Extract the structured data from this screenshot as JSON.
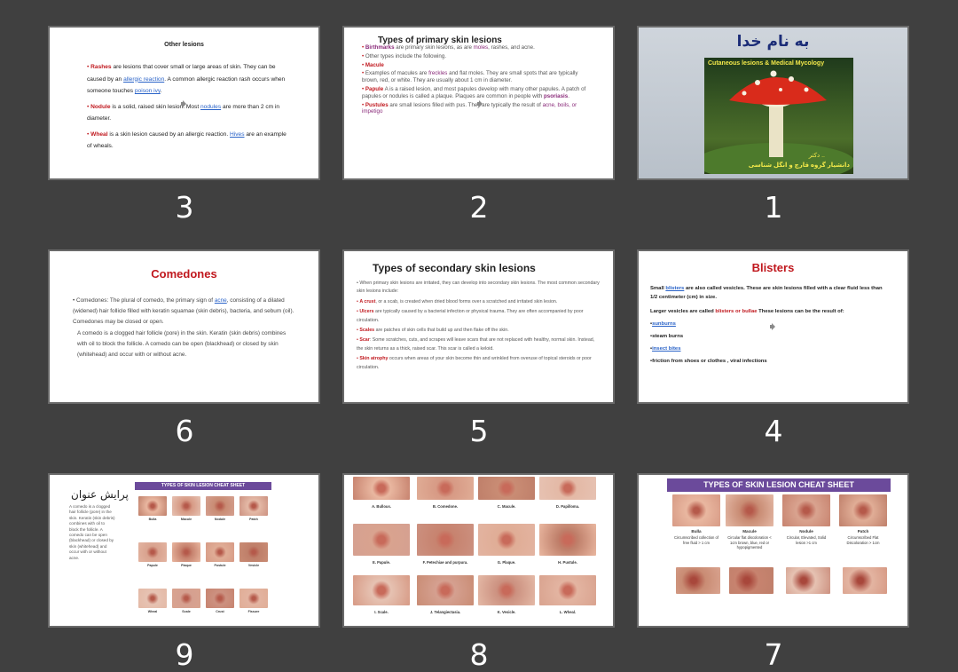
{
  "colors": {
    "background": "#404040",
    "accent_red": "#c0181e",
    "link": "#2a63c8",
    "purple": "#8a2b7a",
    "ribbon": "#6b4a9b"
  },
  "slides": {
    "s1": {
      "number": "1",
      "title": "به نام خدا",
      "subtitle": "Cutaneous lesions & Medical Mycology",
      "author": "دکتر ..",
      "affiliation": "دانشیار گروه قارچ و انگل شناسی"
    },
    "s2": {
      "number": "2",
      "title": "Types of primary skin lesions",
      "items": [
        {
          "head": "Birthmarks",
          "text": " are primary skin lesions, as are ",
          "link": "moles",
          "tail": ", rashes, and acne."
        },
        {
          "head": "",
          "text": "Other types include the following.",
          "link": "",
          "tail": ""
        },
        {
          "head": "Macule",
          "text": "",
          "link": "",
          "tail": ""
        },
        {
          "head": "",
          "text": "Examples of macules are ",
          "link": "freckles",
          "tail": " and flat moles. They are small spots that are typically brown, red, or white. They are usually about 1 cm in diameter."
        },
        {
          "head": "Papule",
          "text": "A  is a raised lesion, and most papules develop with many other papules. A patch of papules or nodules is called a plaque. Plaques are common in people with ",
          "link": "psoriasis",
          "tail": "."
        },
        {
          "head": "Pustules",
          "text": " are small lesions filled with pus. They are typically the result of ",
          "link": "acne, boils,",
          "tail": " or impetigo"
        }
      ]
    },
    "s3": {
      "number": "3",
      "title": "Other lesions",
      "items": [
        {
          "head": "Rashes",
          "text": " are lesions that cover small or large areas of skin. They can be caused by an ",
          "link": "allergic reaction",
          "tail": ". A common allergic reaction rash occurs when someone touches ",
          "link2": "poison ivy",
          "tail2": "."
        },
        {
          "head": "Nodule",
          "text": " is a solid, raised skin lesion. Most ",
          "link": "nodules",
          "tail": " are more than 2 cm in diameter.",
          "link2": "",
          "tail2": ""
        },
        {
          "head": "Wheal",
          "text": " is a skin lesion caused by an allergic reaction. ",
          "link": "Hives",
          "tail": " are an example of wheals.",
          "link2": "",
          "tail2": ""
        }
      ]
    },
    "s4": {
      "number": "4",
      "title": "Blisters",
      "line1a": "Small ",
      "line1link": "blisters",
      "line1b": " are also called vesicles. These are skin lesions filled with a clear fluid less than 1/2 centimeter (cm) in size.",
      "line2a": " Larger vesicles are called ",
      "line2red": "blisters or bullae",
      "line2b": " These lesions can be the result of:",
      "list": [
        "sunburns",
        "steam burns",
        "insect bites",
        "friction from shoes or clothes , viral infections"
      ]
    },
    "s5": {
      "number": "5",
      "title": "Types of secondary skin lesions",
      "intro": "When primary skin lesions are irritated, they can develop into secondary skin lesions. The most common secondary skin lesions include:",
      "items": [
        {
          "head": "A crust",
          "text": ", or a scab, is created when dried blood forms over a scratched and irritated skin lesion."
        },
        {
          "head": "Ulcers",
          "text": " are typically caused by a bacterial infection or physical trauma. They are often accompanied by poor circulation."
        },
        {
          "head": "Scales",
          "text": " are patches of skin cells that build up and then flake off the skin."
        },
        {
          "head": "Scar",
          "text": ": Some scratches, cuts, and scrapes will leave scars that are not replaced with healthy, normal skin. Instead, the skin returns as a thick, raised scar. This scar is called a keloid."
        },
        {
          "head": "Skin atrophy",
          "text": " occurs when areas of your skin become thin and wrinkled from overuse of topical steroids or poor circulation."
        }
      ]
    },
    "s6": {
      "number": "6",
      "title": "Comedones",
      "para1a": "Comedones: The plural of comedo, the primary sign of ",
      "para1link": "acne",
      "para1b": ", consisting of a dilated (widened) hair follicle filled with keratin squamae (skin debris), bacteria, and sebum (oil). Comedones may be closed or open.",
      "para2": "A comedo is a clogged hair follicle (pore) in the skin. Keratin (skin debris) combines with oil to block the follicle. A comedo can be open (blackhead) or closed by skin (whitehead) and occur with or without acne."
    },
    "s7": {
      "number": "7",
      "banner": "TYPES OF SKIN LESION CHEAT SHEET",
      "cells": [
        {
          "name": "Bulla",
          "desc": "Circumscribed collection of free fluid > 1 cm"
        },
        {
          "name": "Macule",
          "desc": "Circular flat discoloration < 1cm brown, blue, red or hypopigmented"
        },
        {
          "name": "Nodule",
          "desc": "Circular, Elevated, Solid lesion >1 cm"
        },
        {
          "name": "Patch",
          "desc": "Circumscribed Flat Discoloration > 1cm"
        }
      ]
    },
    "s8": {
      "number": "8",
      "captions": [
        "A. Bullous.",
        "B. Comedone.",
        "C. Macule.",
        "D. Papilloma.",
        "E. Papule.",
        "F. Petechiae and purpura.",
        "G. Plaque.",
        "H. Pustule.",
        "I. Scale.",
        "J. Telangiectasia.",
        "K. Vesicle.",
        "L. Wheal."
      ]
    },
    "s9": {
      "number": "9",
      "heading": "پرایش عنوان",
      "side_text": "A comedo is a clogged hair follicle (pore) in the skin. Keratin (skin debris) combines with oil to block the follicle. A comedo can be open (blackhead) or closed by skin (whitehead) and occur with or without acne.",
      "banner": "TYPES OF SKIN LESION CHEAT SHEET",
      "cells": [
        "Bulla",
        "Macule",
        "Nodule",
        "Patch",
        "Papule",
        "Plaque",
        "Pustule",
        "Vesicle",
        "Wheal",
        "Scale",
        "Crust",
        "Fissure"
      ]
    }
  }
}
